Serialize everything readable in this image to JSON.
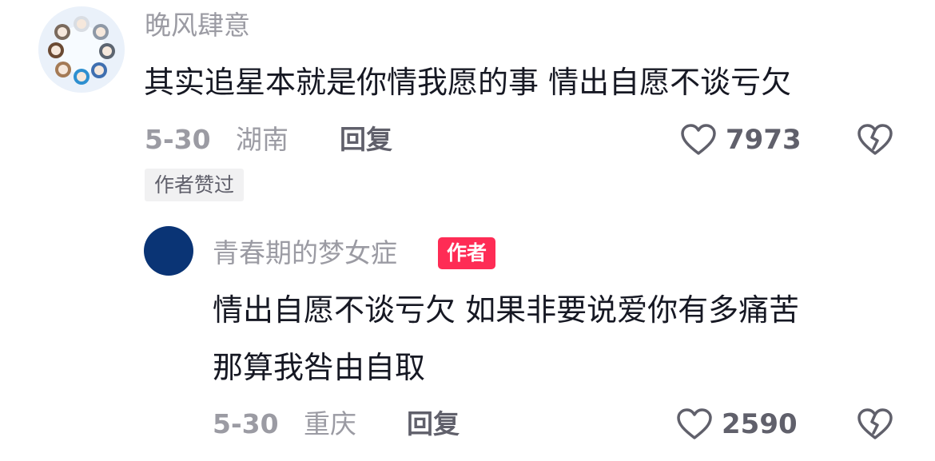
{
  "comment": {
    "username": "晚风肆意",
    "text": "其实追星本就是你情我愿的事 情出自愿不谈亏欠",
    "date": "5-30",
    "location": "湖南",
    "reply_label": "回复",
    "like_count": "7973",
    "badge": "作者赞过",
    "avatar_icon": "group-illustration-avatar",
    "like_icon": "heart-outline-icon",
    "dislike_icon": "broken-heart-icon"
  },
  "reply": {
    "username": "青春期的梦女症",
    "author_tag": "作者",
    "text_line1": "情出自愿不谈亏欠 如果非要说爱你有多痛苦",
    "text_line2": "那算我咎由自取",
    "date": "5-30",
    "location": "重庆",
    "reply_label": "回复",
    "like_count": "2590",
    "avatar_color": "#0a3475",
    "like_icon": "heart-outline-icon",
    "dislike_icon": "broken-heart-icon"
  },
  "colors": {
    "text_primary": "#161823",
    "text_secondary": "#9b9ba3",
    "text_action": "#60606b",
    "author_badge": "#fe2c55",
    "liked_badge_bg": "#f1f1f2"
  }
}
